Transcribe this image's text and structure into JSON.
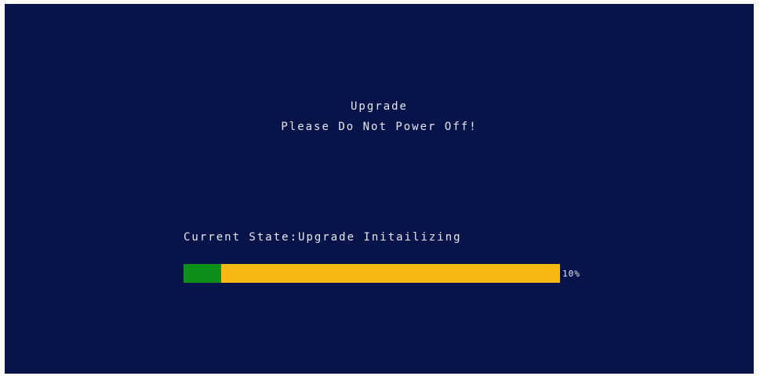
{
  "dialog": {
    "title": "Upgrade",
    "warning": "Please Do Not Power Off!"
  },
  "status": {
    "label": "Current State:",
    "value": "Upgrade Initailizing"
  },
  "progress": {
    "fraction": 0.1,
    "label": "10%",
    "fill_color": "#0e8f1a",
    "track_color": "#f5b912"
  },
  "colors": {
    "background": "#07144a",
    "text": "#e6e8f2"
  }
}
